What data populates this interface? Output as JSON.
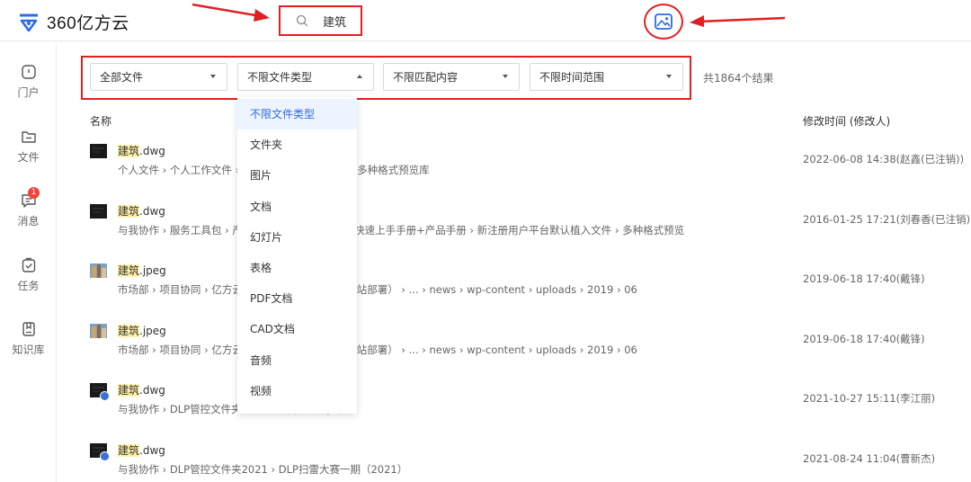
{
  "app": {
    "title": "360亿方云"
  },
  "search": {
    "query": "建筑"
  },
  "sidebar": {
    "items": [
      {
        "label": "门户",
        "icon": "home-icon"
      },
      {
        "label": "文件",
        "icon": "folder-icon"
      },
      {
        "label": "消息",
        "icon": "message-icon",
        "badge": "1"
      },
      {
        "label": "任务",
        "icon": "task-icon"
      },
      {
        "label": "知识库",
        "icon": "book-icon"
      }
    ]
  },
  "filters": [
    {
      "label": "全部文件"
    },
    {
      "label": "不限文件类型"
    },
    {
      "label": "不限匹配内容"
    },
    {
      "label": "不限时间范围"
    }
  ],
  "result_count": "共1864个结果",
  "table": {
    "col_name": "名称",
    "col_time": "修改时间 (修改人)"
  },
  "dropdown": {
    "items": [
      "不限文件类型",
      "文件夹",
      "图片",
      "文档",
      "幻灯片",
      "表格",
      "PDF文档",
      "CAD文档",
      "音频",
      "视频"
    ],
    "selected": "不限文件类型"
  },
  "files": [
    {
      "highlight": "建筑",
      "ext": ".dwg",
      "thumb": "dwg",
      "path": "个人文件 › 个人工作文件 › 产品测试文件 › 文件夹 › 多种格式预览库",
      "time": "2022-06-08 14:38(赵鑫(已注销))"
    },
    {
      "highlight": "建筑",
      "ext": ".dwg",
      "thumb": "dwg",
      "path": "与我协作 › 服务工具包 › 产品使用手册合集 › FAQ+快速上手手册+产品手册 › 新注册用户平台默认植入文件 › 多种格式预览",
      "time": "2016-01-25 17:21(刘春香(已注销))"
    },
    {
      "highlight": "建筑",
      "ext": ".jpeg",
      "thumb": "jpeg",
      "path": "市场部 › 项目协同 › 亿方云官网设计项目 › 二期（网站部署） › ... › news › wp-content › uploads › 2019 › 06",
      "time": "2019-06-18 17:40(戴锋)"
    },
    {
      "highlight": "建筑",
      "ext": ".jpeg",
      "thumb": "jpeg",
      "path": "市场部 › 项目协同 › 亿方云官网设计项目 › 二期（网站部署） › ... › news › wp-content › uploads › 2019 › 06",
      "time": "2019-06-18 17:40(戴锋)"
    },
    {
      "highlight": "建筑",
      "ext": ".dwg",
      "thumb": "dwg-shared",
      "path": "与我协作 › DLP管控文件夹 › DLP文件预览演示 (1)",
      "time": "2021-10-27 15:11(李江丽)"
    },
    {
      "highlight": "建筑",
      "ext": ".dwg",
      "thumb": "dwg-shared",
      "path": "与我协作 › DLP管控文件夹2021 › DLP扫雷大赛一期（2021）",
      "time": "2021-08-24 11:04(曹新杰)"
    }
  ],
  "colors": {
    "accent": "#2b6ce5",
    "annotation_red": "#e02020",
    "highlight": "#fff2a8",
    "badge": "#f5433a"
  }
}
